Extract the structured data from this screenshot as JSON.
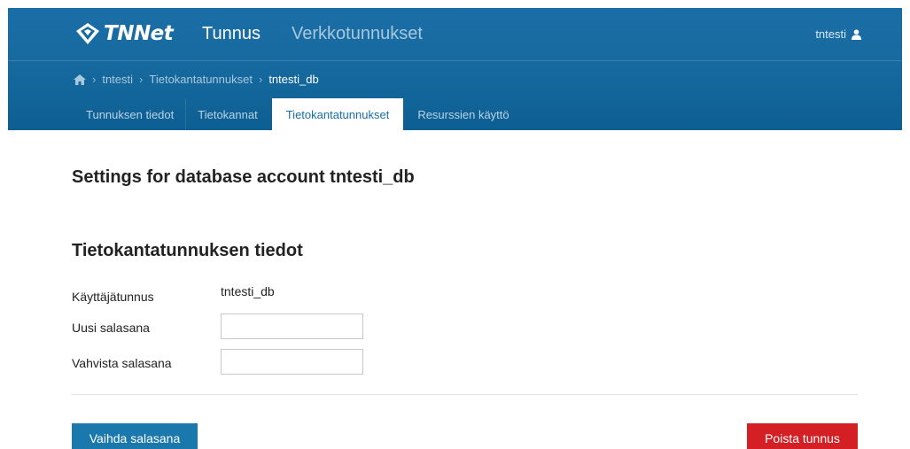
{
  "header": {
    "logo_text": "TNNet",
    "nav_main": "Tunnus",
    "nav_sub": "Verkkotunnukset",
    "user_name": "tntesti",
    "colors": {
      "header_bg": "#176a9f",
      "active_tab_text": "#1a6ea7"
    }
  },
  "breadcrumb": {
    "home_icon": "home-icon",
    "items": [
      "tntesti",
      "Tietokantatunnukset"
    ],
    "current": "tntesti_db"
  },
  "tabs": [
    {
      "label": "Tunnuksen tiedot",
      "active": false
    },
    {
      "label": "Tietokannat",
      "active": false
    },
    {
      "label": "Tietokantatunnukset",
      "active": true
    },
    {
      "label": "Resurssien käyttö",
      "active": false
    }
  ],
  "main": {
    "page_title": "Settings for database account tntesti_db",
    "section_title": "Tietokantatunnuksen tiedot",
    "form": {
      "username_label": "Käyttäjätunnus",
      "username_value": "tntesti_db",
      "new_password_label": "Uusi salasana",
      "new_password_value": "",
      "confirm_password_label": "Vahvista salasana",
      "confirm_password_value": ""
    },
    "buttons": {
      "change_password": "Vaihda salasana",
      "delete_account": "Poista tunnus"
    },
    "colors": {
      "primary": "#1a78ad",
      "danger": "#d41f25"
    }
  }
}
